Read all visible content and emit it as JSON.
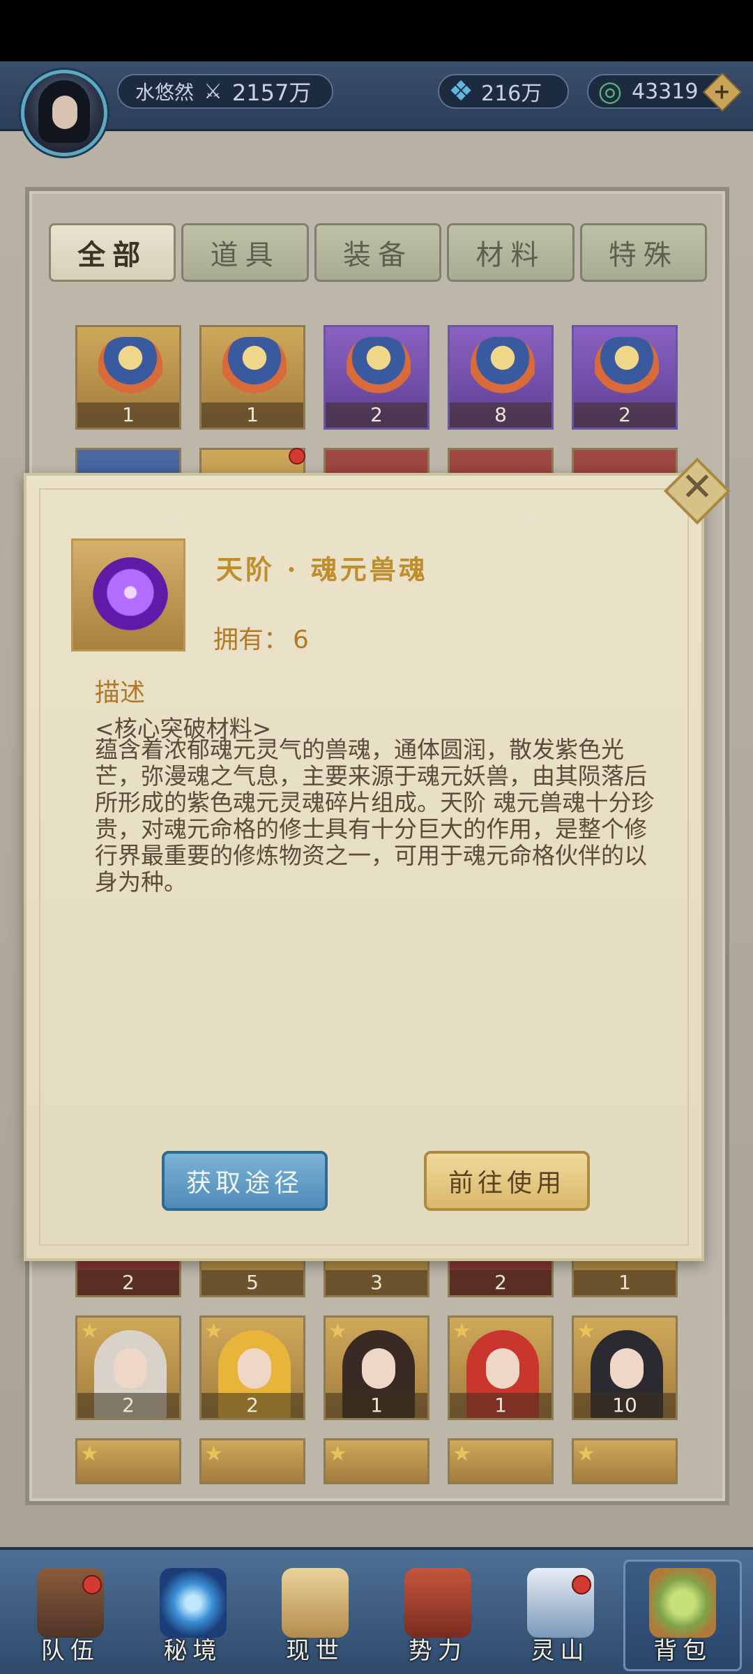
{
  "header": {
    "player_name": "水悠然",
    "power_icon": "sword-power-icon",
    "power": "2157万",
    "jade": "216万",
    "coins": "43319",
    "plus": "+"
  },
  "tabs": [
    {
      "label": "全部",
      "active": true
    },
    {
      "label": "道具",
      "active": false
    },
    {
      "label": "装备",
      "active": false
    },
    {
      "label": "材料",
      "active": false
    },
    {
      "label": "特殊",
      "active": false
    }
  ],
  "row1": [
    "1",
    "1",
    "2",
    "8",
    "2"
  ],
  "row_partial_qty": [
    "2",
    "5",
    "3",
    "2",
    "1"
  ],
  "row_chars": [
    "2",
    "2",
    "1",
    "1",
    "10"
  ],
  "dialog": {
    "close": "✕",
    "title": "天阶 · 魂元兽魂",
    "owned_label": "拥有：",
    "owned_value": "6",
    "desc_heading": "描述",
    "desc_tag": "<核心突破材料>",
    "desc_body": "蕴含着浓郁魂元灵气的兽魂，通体圆润，散发紫色光芒，弥漫魂之气息，主要来源于魂元妖兽，由其陨落后所形成的紫色魂元灵魂碎片组成。天阶 魂元兽魂十分珍贵，对魂元命格的修士具有十分巨大的作用，是整个修行界最重要的修炼物资之一，可用于魂元命格伙伴的以身为种。",
    "btn_source": "获取途径",
    "btn_use": "前往使用"
  },
  "nav": [
    {
      "label": "队伍",
      "icon": "team-icon",
      "dot": true
    },
    {
      "label": "秘境",
      "icon": "vortex-icon",
      "dot": false
    },
    {
      "label": "现世",
      "icon": "map-scroll-icon",
      "dot": false
    },
    {
      "label": "势力",
      "icon": "palace-icon",
      "dot": false
    },
    {
      "label": "灵山",
      "icon": "mountain-icon",
      "dot": true
    },
    {
      "label": "背包",
      "icon": "bag-icon",
      "dot": false,
      "active": true
    }
  ]
}
